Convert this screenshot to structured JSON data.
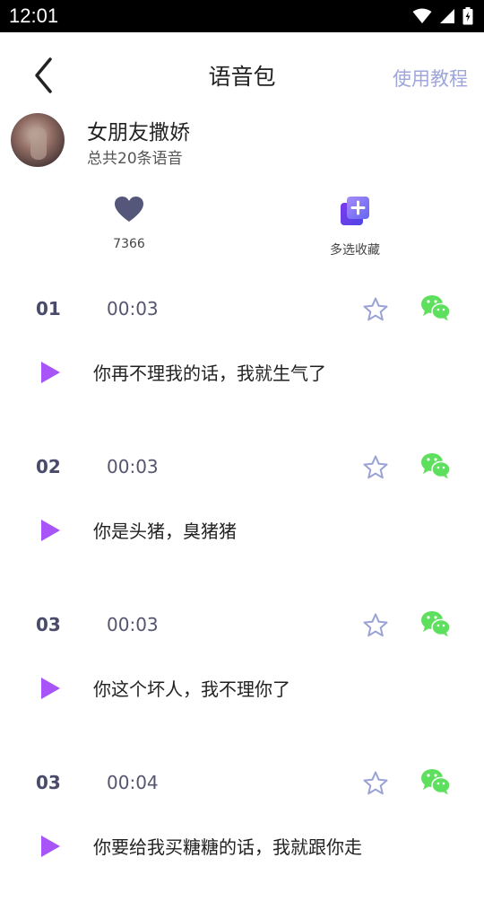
{
  "status": {
    "time": "12:01"
  },
  "nav": {
    "title": "语音包",
    "tutorial_label": "使用教程"
  },
  "pack": {
    "name": "女朋友撒娇",
    "count_text": "总共20条语音"
  },
  "actions": {
    "likes": "7366",
    "multi_select_label": "多选收藏"
  },
  "colors": {
    "accent": "#9ea6da",
    "play": "#a855f7",
    "wechat": "#5ee05e",
    "like": "#55577a"
  },
  "items": [
    {
      "index": "01",
      "duration": "00:03",
      "text": "你再不理我的话，我就生气了"
    },
    {
      "index": "02",
      "duration": "00:03",
      "text": "你是头猪，臭猪猪"
    },
    {
      "index": "03",
      "duration": "00:03",
      "text": "你这个坏人，我不理你了"
    },
    {
      "index": "03",
      "duration": "00:04",
      "text": "你要给我买糖糖的话，我就跟你走"
    }
  ]
}
